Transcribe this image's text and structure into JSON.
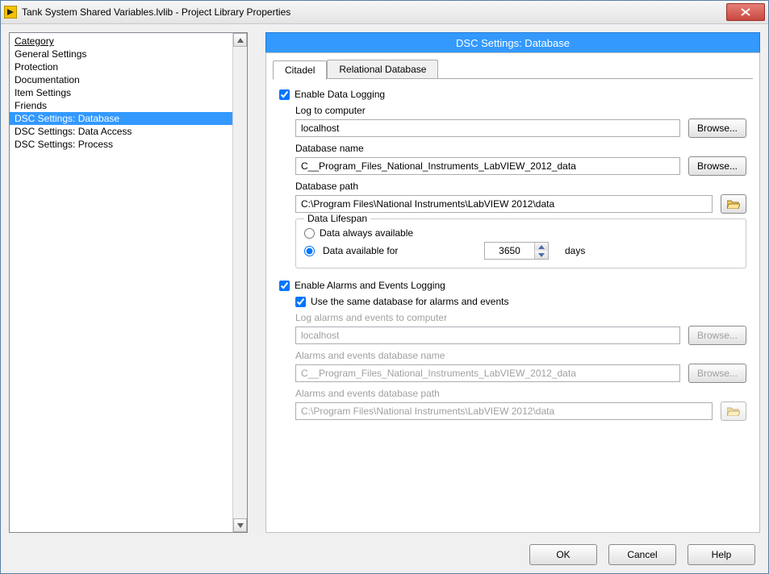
{
  "window": {
    "title": "Tank System Shared Variables.lvlib - Project Library Properties"
  },
  "category": {
    "header": "Category",
    "items": [
      "General Settings",
      "Protection",
      "Documentation",
      "Item Settings",
      "Friends",
      "DSC Settings: Database",
      "DSC Settings: Data Access",
      "DSC Settings: Process"
    ],
    "selected_index": 5
  },
  "panel": {
    "title": "DSC Settings: Database",
    "tabs": [
      "Citadel",
      "Relational Database"
    ],
    "active_tab": 0
  },
  "data_logging": {
    "enable_label": "Enable Data Logging",
    "enable_checked": true,
    "log_to_label": "Log to computer",
    "log_to_value": "localhost",
    "browse_label": "Browse...",
    "db_name_label": "Database name",
    "db_name_value": "C__Program_Files_National_Instruments_LabVIEW_2012_data",
    "db_path_label": "Database path",
    "db_path_value": "C:\\Program Files\\National Instruments\\LabVIEW 2012\\data"
  },
  "lifespan": {
    "legend": "Data Lifespan",
    "always_label": "Data always available",
    "available_for_label": "Data available for",
    "selected": "available_for",
    "days_value": "3650",
    "days_unit": "days"
  },
  "alarms": {
    "enable_label": "Enable Alarms and Events Logging",
    "enable_checked": true,
    "same_db_label": "Use the same database for alarms and events",
    "same_db_checked": true,
    "log_to_label": "Log alarms and events to computer",
    "log_to_value": "localhost",
    "browse_label": "Browse...",
    "db_name_label": "Alarms and events database name",
    "db_name_value": "C__Program_Files_National_Instruments_LabVIEW_2012_data",
    "db_path_label": "Alarms and events database path",
    "db_path_value": "C:\\Program Files\\National Instruments\\LabVIEW 2012\\data"
  },
  "footer": {
    "ok": "OK",
    "cancel": "Cancel",
    "help": "Help"
  }
}
